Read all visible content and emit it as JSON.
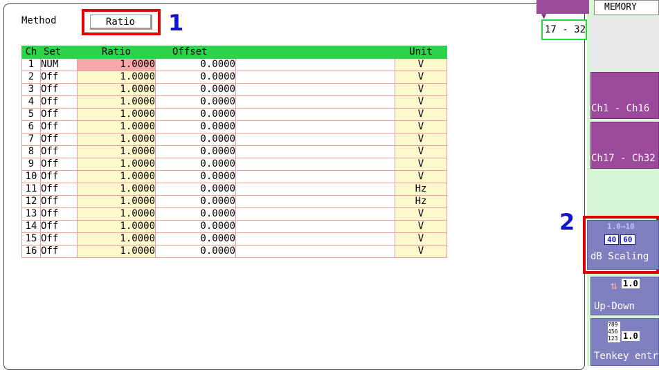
{
  "method": {
    "label": "Method",
    "value": "Ratio"
  },
  "callouts": {
    "one": "1",
    "two_table": "2",
    "two_side": "2"
  },
  "table": {
    "headers": [
      "Ch",
      "Set",
      "Ratio",
      "Offset",
      "",
      "Unit"
    ],
    "rows": [
      {
        "ch": "1",
        "set": "NUM",
        "ratio": "1.0000",
        "offset": "0.0000",
        "unit": "V"
      },
      {
        "ch": "2",
        "set": "Off",
        "ratio": "1.0000",
        "offset": "0.0000",
        "unit": "V"
      },
      {
        "ch": "3",
        "set": "Off",
        "ratio": "1.0000",
        "offset": "0.0000",
        "unit": "V"
      },
      {
        "ch": "4",
        "set": "Off",
        "ratio": "1.0000",
        "offset": "0.0000",
        "unit": "V"
      },
      {
        "ch": "5",
        "set": "Off",
        "ratio": "1.0000",
        "offset": "0.0000",
        "unit": "V"
      },
      {
        "ch": "6",
        "set": "Off",
        "ratio": "1.0000",
        "offset": "0.0000",
        "unit": "V"
      },
      {
        "ch": "7",
        "set": "Off",
        "ratio": "1.0000",
        "offset": "0.0000",
        "unit": "V"
      },
      {
        "ch": "8",
        "set": "Off",
        "ratio": "1.0000",
        "offset": "0.0000",
        "unit": "V"
      },
      {
        "ch": "9",
        "set": "Off",
        "ratio": "1.0000",
        "offset": "0.0000",
        "unit": "V"
      },
      {
        "ch": "10",
        "set": "Off",
        "ratio": "1.0000",
        "offset": "0.0000",
        "unit": "V"
      },
      {
        "ch": "11",
        "set": "Off",
        "ratio": "1.0000",
        "offset": "0.0000",
        "unit": "Hz"
      },
      {
        "ch": "12",
        "set": "Off",
        "ratio": "1.0000",
        "offset": "0.0000",
        "unit": "Hz"
      },
      {
        "ch": "13",
        "set": "Off",
        "ratio": "1.0000",
        "offset": "0.0000",
        "unit": "V"
      },
      {
        "ch": "14",
        "set": "Off",
        "ratio": "1.0000",
        "offset": "0.0000",
        "unit": "V"
      },
      {
        "ch": "15",
        "set": "Off",
        "ratio": "1.0000",
        "offset": "0.0000",
        "unit": "V"
      },
      {
        "ch": "16",
        "set": "Off",
        "ratio": "1.0000",
        "offset": "0.0000",
        "unit": "V"
      }
    ]
  },
  "sidebar": {
    "tab_range": "17 - 32",
    "memory_tab": "MEMORY",
    "ch_group_1": "Ch1 - Ch16",
    "ch_group_2": "Ch17 - Ch32",
    "db_icon_top": "1.0→10",
    "db_icon_bottom": [
      "40",
      "60"
    ],
    "db_scaling": "dB Scaling",
    "updown_icon": "1.0",
    "updown": "Up-Down",
    "tenkey_icon_digits": "789\n456\n123",
    "tenkey_icon_value": "1.0",
    "tenkey": "Tenkey entry"
  },
  "colors": {
    "header_green": "#2ed24a",
    "cell_yellow": "#fffacd",
    "selected_pink": "#f8a8a8",
    "highlight_red": "#e00000",
    "callout_blue": "#1414c8",
    "side_purple": "#9c4a9c",
    "side_blue": "#8080c0"
  }
}
